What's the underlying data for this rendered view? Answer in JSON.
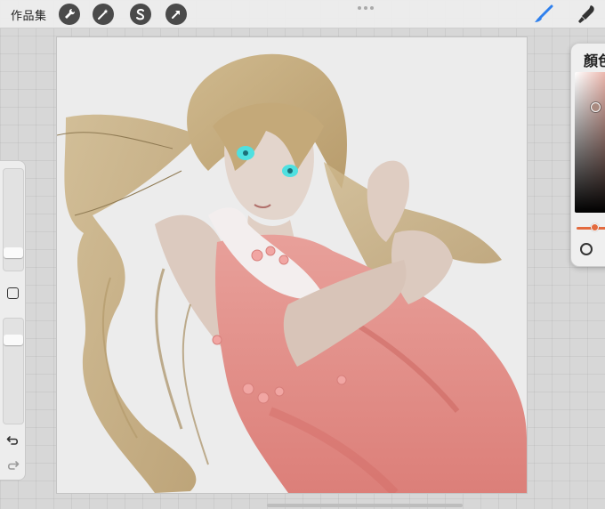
{
  "toolbar": {
    "gallery_label": "作品集",
    "tools": [
      {
        "icon": "wrench-icon",
        "name": "actions"
      },
      {
        "icon": "magic-wand-icon",
        "name": "adjustments"
      },
      {
        "icon": "selection-s-icon",
        "name": "selection"
      },
      {
        "icon": "arrow-cursor-icon",
        "name": "transform"
      }
    ],
    "right_tools": [
      {
        "icon": "brush-icon",
        "color": "#2f80ed"
      },
      {
        "icon": "smudge-icon",
        "color": "#333333"
      }
    ]
  },
  "sidebar": {
    "brush_size_level": 0.28,
    "opacity_level": 0.22,
    "undo_icon": "undo-icon",
    "redo_icon": "redo-icon"
  },
  "canvas": {
    "background": "#ececec",
    "palette": {
      "hair": "#c9b184",
      "hair_shadow": "#a88e62",
      "skin": "#e3d5cc",
      "dress": "#e58e88",
      "eyes": "#4fe0e0",
      "flower": "#f1a6a3"
    }
  },
  "color_panel": {
    "title": "顏色",
    "hue_color": "#e36a3e",
    "selected_color": "#a98a80"
  }
}
